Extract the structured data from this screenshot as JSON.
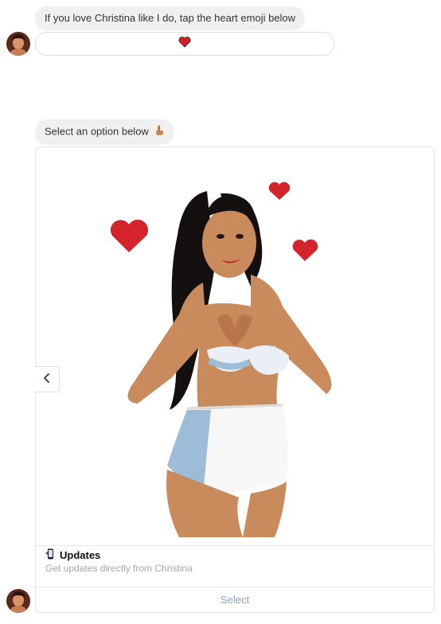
{
  "messages": {
    "first_text": "If you love Christina like I do, tap the heart emoji below",
    "heart_emoji": "❤️",
    "second_text": "Select an option below",
    "point_down_emoji": "👇"
  },
  "card": {
    "image_icon": "cartoon-woman-heart-hands-illustration",
    "title_icon": "phone-icon",
    "title": "Updates",
    "subtitle": "Get updates directly from Christina",
    "select_label": "Select",
    "prev_icon": "chevron-left-icon"
  },
  "colors": {
    "bubble_bg": "#f0f0f0",
    "heart": "#d0202a",
    "select_text": "#8aa2c0",
    "subtitle_text": "#a6a6a6"
  }
}
